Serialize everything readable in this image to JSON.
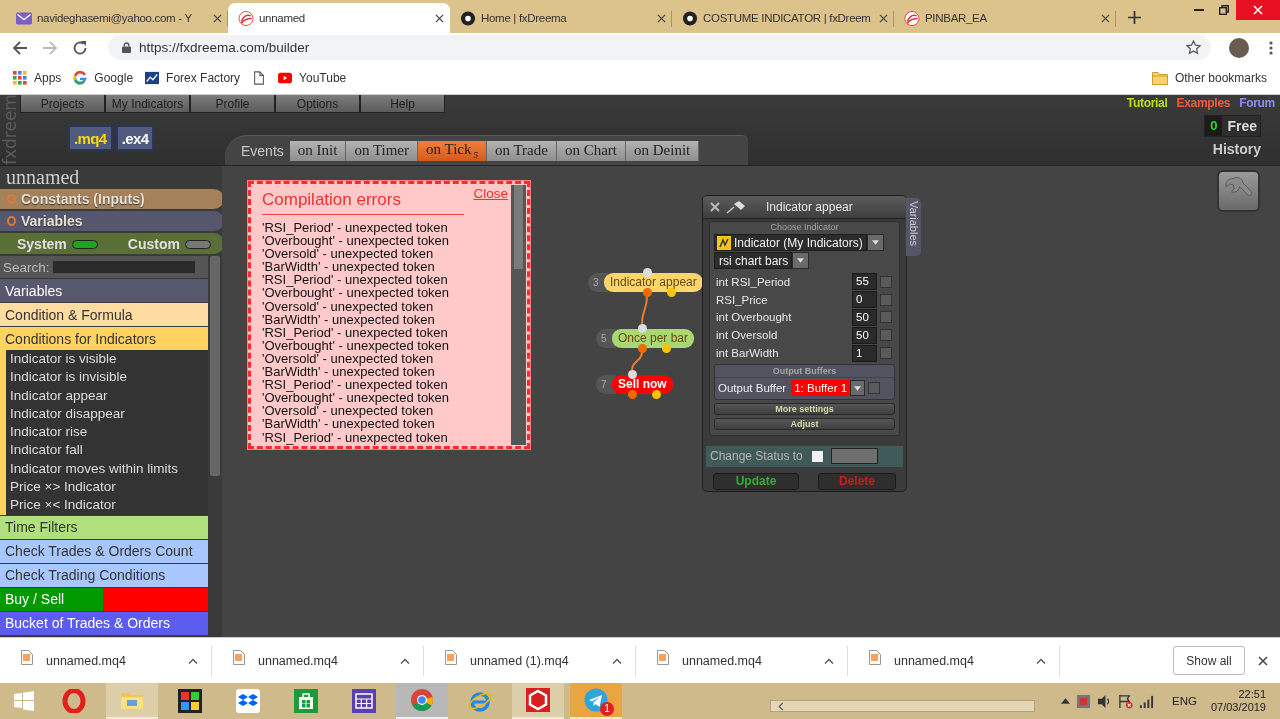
{
  "browser": {
    "tabs": [
      {
        "kind": "mail",
        "title": "navideghasemi@yahoo.com - Y",
        "selected": false
      },
      {
        "kind": "swirl",
        "title": "unnamed",
        "selected": true
      },
      {
        "kind": "gear",
        "title": "Home | fxDreema",
        "selected": false
      },
      {
        "kind": "gear",
        "title": "COSTUME INDICATOR | fxDreem",
        "selected": false
      },
      {
        "kind": "swirl",
        "title": "PINBAR_EA",
        "selected": false
      }
    ],
    "url": "https://fxdreema.com/builder",
    "bookmarks": [
      {
        "kind": "apps",
        "label": "Apps"
      },
      {
        "kind": "google",
        "label": "Google"
      },
      {
        "kind": "forex",
        "label": "Forex Factory"
      },
      {
        "kind": "page"
      },
      {
        "kind": "video",
        "label": "YouTube"
      }
    ],
    "other_bookmarks": "Other bookmarks"
  },
  "app": {
    "logo": "fxdreem",
    "menu": [
      "Projects",
      "My Indicators",
      "Profile",
      "Options",
      "Help"
    ],
    "formats": [
      {
        "label": ".mq4",
        "selected": true
      },
      {
        "label": ".ex4",
        "selected": false
      }
    ],
    "links": [
      {
        "label": "Tutorial",
        "color": "#b8e01c"
      },
      {
        "label": "Examples",
        "color": "#f25a3a"
      },
      {
        "label": "Forum",
        "color": "#8c8cf0"
      }
    ],
    "plan": {
      "count": "0",
      "label": "Free"
    },
    "history": "History",
    "events": {
      "label": "Events",
      "tabs": [
        {
          "label": "on Init",
          "selected": false
        },
        {
          "label": "on Timer",
          "selected": false
        },
        {
          "label": "on Tick",
          "count": "5",
          "selected": true
        },
        {
          "label": "on Trade",
          "selected": false
        },
        {
          "label": "on Chart",
          "selected": false
        },
        {
          "label": "on Deinit",
          "selected": false
        }
      ]
    },
    "sidebar": {
      "project": "unnamed",
      "sections": [
        {
          "label": "Constants (Inputs)",
          "color": "#a4815a"
        },
        {
          "label": "Variables",
          "color": "#56566c"
        }
      ],
      "toggles": [
        {
          "label": "System",
          "on": true
        },
        {
          "label": "Custom",
          "on": false
        }
      ],
      "search": {
        "label": "Search:"
      },
      "categories": [
        {
          "label": "Variables",
          "color": "#57576d"
        },
        {
          "label": "Condition & Formula",
          "color": "#ffdca2"
        },
        {
          "label": "Conditions for Indicators",
          "color": "#ffd35e",
          "children": [
            "Indicator is visible",
            "Indicator is invisible",
            "Indicator appear",
            "Indicator disappear",
            "Indicator rise",
            "Indicator fall",
            "Indicator moves within limits",
            "Price ×> Indicator",
            "Price ×< Indicator"
          ]
        },
        {
          "label": "Time Filters",
          "color": "#b1e07e"
        },
        {
          "label": "Check Trades & Orders Count",
          "color": "#a9c7ff"
        },
        {
          "label": "Check Trading Conditions",
          "color": "#a9c7ff"
        },
        {
          "label": "Buy / Sell",
          "color": "#009a00",
          "split": {
            "color": "#ff0000"
          }
        },
        {
          "label": "Bucket of Trades & Orders",
          "color": "#5c5cf0"
        }
      ]
    },
    "errors": {
      "title": "Compilation errors",
      "close": "Close",
      "lines": [
        "'RSI_Period' - unexpected token",
        "'Overbought' - unexpected token",
        "'Oversold' - unexpected token",
        "'BarWidth' - unexpected token",
        "'RSI_Period' - unexpected token",
        "'Overbought' - unexpected token",
        "'Oversold' - unexpected token",
        "'BarWidth' - unexpected token",
        "'RSI_Period' - unexpected token",
        "'Overbought' - unexpected token",
        "'Oversold' - unexpected token",
        "'BarWidth' - unexpected token",
        "'RSI_Period' - unexpected token",
        "'Overbought' - unexpected token",
        "'Oversold' - unexpected token",
        "'BarWidth' - unexpected token",
        "'RSI_Period' - unexpected token"
      ]
    },
    "nodes": [
      {
        "number": "3",
        "label": "Indicator appear",
        "color": "#f9d66b"
      },
      {
        "number": "5",
        "label": "Once per bar",
        "color": "#a9d873"
      },
      {
        "number": "7",
        "label": "Sell now",
        "color": "#ff0000"
      }
    ],
    "dialog": {
      "title": "Indicator appear",
      "side_tab": "Variables",
      "section": "Choose Indicator",
      "source": "Indicator (My Indicators)",
      "indicator": "rsi chart bars",
      "params": [
        {
          "label": "int RSI_Period",
          "value": "55",
          "checked": false
        },
        {
          "label": "RSI_Price",
          "value": "0",
          "checked": false
        },
        {
          "label": "int Overbought",
          "value": "50",
          "checked": false
        },
        {
          "label": "int Oversold",
          "value": "50",
          "checked": false
        },
        {
          "label": "int BarWidth",
          "value": "1",
          "checked": false
        }
      ],
      "buffers": {
        "title": "Output Buffers",
        "label": "Output Buffer",
        "value": "1: Buffer 1",
        "checked": false
      },
      "more_settings": "More settings",
      "adjust": "Adjust",
      "status": {
        "label": "Change Status to",
        "checked": false
      },
      "buttons": [
        {
          "kind": "update",
          "label": "Update"
        },
        {
          "kind": "delete",
          "label": "Delete"
        }
      ]
    }
  },
  "downloads": {
    "files": [
      "unnamed.mq4",
      "unnamed.mq4",
      "unnamed (1).mq4",
      "unnamed.mq4",
      "unnamed.mq4"
    ],
    "show_all": "Show all"
  },
  "taskbar": {
    "apps": [
      {
        "kind": "opera",
        "open": false,
        "selected": false,
        "flashing": false
      },
      {
        "kind": "files",
        "open": true,
        "selected": false,
        "flashing": false
      },
      {
        "kind": "puzzle",
        "open": false,
        "selected": false,
        "flashing": false
      },
      {
        "kind": "dropbox",
        "open": false,
        "selected": false,
        "flashing": false
      },
      {
        "kind": "store",
        "open": false,
        "selected": false,
        "flashing": false
      },
      {
        "kind": "calc",
        "open": false,
        "selected": false,
        "flashing": false
      },
      {
        "kind": "chrome",
        "open": true,
        "selected": true,
        "flashing": false
      },
      {
        "kind": "ie",
        "open": false,
        "selected": false,
        "flashing": false
      },
      {
        "kind": "hexagon",
        "open": true,
        "selected": false,
        "flashing": false
      },
      {
        "kind": "telegram",
        "open": true,
        "selected": false,
        "flashing": true,
        "badge": "1"
      }
    ],
    "language": "ENG",
    "time": "22:51",
    "date": "07/03/2019"
  }
}
